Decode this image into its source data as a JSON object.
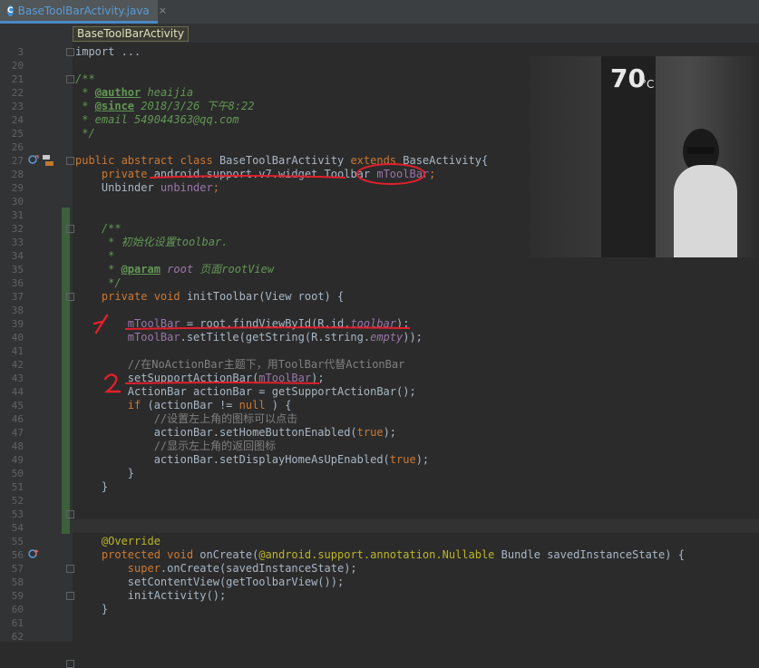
{
  "tab": {
    "title": "BaseToolBarActivity.java",
    "icon": "C",
    "close": "×"
  },
  "breadcrumb": "BaseToolBarActivity",
  "lines": [
    {
      "n": "3",
      "parts": [
        [
          "",
          "import ..."
        ]
      ]
    },
    {
      "n": "20",
      "parts": []
    },
    {
      "n": "21",
      "parts": [
        [
          "doc",
          "/**"
        ]
      ]
    },
    {
      "n": "22",
      "parts": [
        [
          "doc",
          " * "
        ],
        [
          "tag",
          "@author"
        ],
        [
          "doc",
          " heaijia"
        ]
      ]
    },
    {
      "n": "23",
      "parts": [
        [
          "doc",
          " * "
        ],
        [
          "tag",
          "@since"
        ],
        [
          "doc",
          " 2018/3/26 下午8:22"
        ]
      ]
    },
    {
      "n": "24",
      "parts": [
        [
          "doc",
          " * email 549044363@qq.com"
        ]
      ]
    },
    {
      "n": "25",
      "parts": [
        [
          "doc",
          " */"
        ]
      ]
    },
    {
      "n": "26",
      "parts": []
    },
    {
      "n": "27",
      "parts": [
        [
          "kw",
          "public abstract class "
        ],
        [
          "",
          "BaseToolBarActivity "
        ],
        [
          "kw",
          "extends "
        ],
        [
          "",
          "BaseActivity{"
        ]
      ]
    },
    {
      "n": "28",
      "parts": [
        [
          "kw",
          "    private "
        ],
        [
          "",
          "android.support.v7.widget.Toolbar "
        ],
        [
          "field",
          "mToolBar"
        ],
        [
          "kw",
          ";"
        ]
      ]
    },
    {
      "n": "29",
      "parts": [
        [
          "",
          "    Unbinder "
        ],
        [
          "field",
          "unbinder"
        ],
        [
          "kw",
          ";"
        ]
      ]
    },
    {
      "n": "30",
      "parts": []
    },
    {
      "n": "31",
      "parts": []
    },
    {
      "n": "32",
      "parts": [
        [
          "doc",
          "    /**"
        ]
      ]
    },
    {
      "n": "33",
      "parts": [
        [
          "doc",
          "     * 初始化设置toolbar."
        ]
      ]
    },
    {
      "n": "34",
      "parts": [
        [
          "doc",
          "     *"
        ]
      ]
    },
    {
      "n": "35",
      "parts": [
        [
          "doc",
          "     * "
        ],
        [
          "tag",
          "@param"
        ],
        [
          "doc",
          " "
        ],
        [
          "ital",
          "root"
        ],
        [
          "doc",
          " 页面rootView"
        ]
      ]
    },
    {
      "n": "36",
      "parts": [
        [
          "doc",
          "     */"
        ]
      ]
    },
    {
      "n": "37",
      "parts": [
        [
          "kw",
          "    private void "
        ],
        [
          "",
          "initToolbar(View root) {"
        ]
      ]
    },
    {
      "n": "38",
      "parts": []
    },
    {
      "n": "39",
      "parts": [
        [
          "field",
          "        mToolBar"
        ],
        [
          "",
          " = root.findViewById(R.id."
        ],
        [
          "ital",
          "toolbar"
        ],
        [
          "",
          "); "
        ]
      ]
    },
    {
      "n": "40",
      "parts": [
        [
          "field",
          "        mToolBar"
        ],
        [
          "",
          ".setTitle(getString(R.string."
        ],
        [
          "ital",
          "empty"
        ],
        [
          "",
          "));"
        ]
      ]
    },
    {
      "n": "41",
      "parts": []
    },
    {
      "n": "42",
      "parts": [
        [
          "cm",
          "        //在NoActionBar主题下，用ToolBar代替ActionBar"
        ]
      ]
    },
    {
      "n": "43",
      "parts": [
        [
          "",
          "        setSupportActionBar("
        ],
        [
          "field",
          "mToolBar"
        ],
        [
          "",
          ");"
        ]
      ]
    },
    {
      "n": "44",
      "parts": [
        [
          "",
          "        ActionBar actionBar = getSupportActionBar();"
        ]
      ]
    },
    {
      "n": "45",
      "parts": [
        [
          "kw",
          "        if "
        ],
        [
          "",
          "(actionBar != "
        ],
        [
          "kw",
          "null"
        ],
        [
          "",
          " ) {"
        ]
      ]
    },
    {
      "n": "46",
      "parts": [
        [
          "cm",
          "            //设置左上角的图标可以点击"
        ]
      ]
    },
    {
      "n": "47",
      "parts": [
        [
          "",
          "            actionBar.setHomeButtonEnabled("
        ],
        [
          "kw",
          "true"
        ],
        [
          "",
          ");"
        ]
      ]
    },
    {
      "n": "48",
      "parts": [
        [
          "cm",
          "            //显示左上角的返回图标"
        ]
      ]
    },
    {
      "n": "49",
      "parts": [
        [
          "",
          "            actionBar.setDisplayHomeAsUpEnabled("
        ],
        [
          "kw",
          "true"
        ],
        [
          "",
          ");"
        ]
      ]
    },
    {
      "n": "50",
      "parts": [
        [
          "",
          "        }"
        ]
      ]
    },
    {
      "n": "51",
      "parts": [
        [
          "",
          "    }"
        ]
      ]
    },
    {
      "n": "52",
      "parts": []
    },
    {
      "n": "53",
      "parts": []
    },
    {
      "n": "54",
      "parts": []
    },
    {
      "n": "55",
      "parts": [
        [
          "ann",
          "    @Override"
        ]
      ]
    },
    {
      "n": "56",
      "parts": [
        [
          "kw",
          "    protected void "
        ],
        [
          "",
          "onCreate("
        ],
        [
          "ann",
          "@android.support.annotation."
        ],
        [
          "ann",
          "Nullable"
        ],
        [
          "",
          " Bundle savedInstanceState) {"
        ]
      ]
    },
    {
      "n": "57",
      "parts": [
        [
          "kw",
          "        super"
        ],
        [
          "",
          ".onCreate(savedInstanceState);"
        ]
      ]
    },
    {
      "n": "58",
      "parts": [
        [
          "",
          "        setContentView(getToolbarView());"
        ]
      ]
    },
    {
      "n": "59",
      "parts": [
        [
          "",
          "        initActivity();"
        ]
      ]
    },
    {
      "n": "60",
      "parts": [
        [
          "",
          "    }"
        ]
      ]
    },
    {
      "n": "61",
      "parts": []
    },
    {
      "n": "62",
      "parts": []
    }
  ],
  "photo": {
    "sign_text": "70",
    "sign_unit": "°C"
  },
  "annotations": {
    "one": "1",
    "two": "2"
  }
}
